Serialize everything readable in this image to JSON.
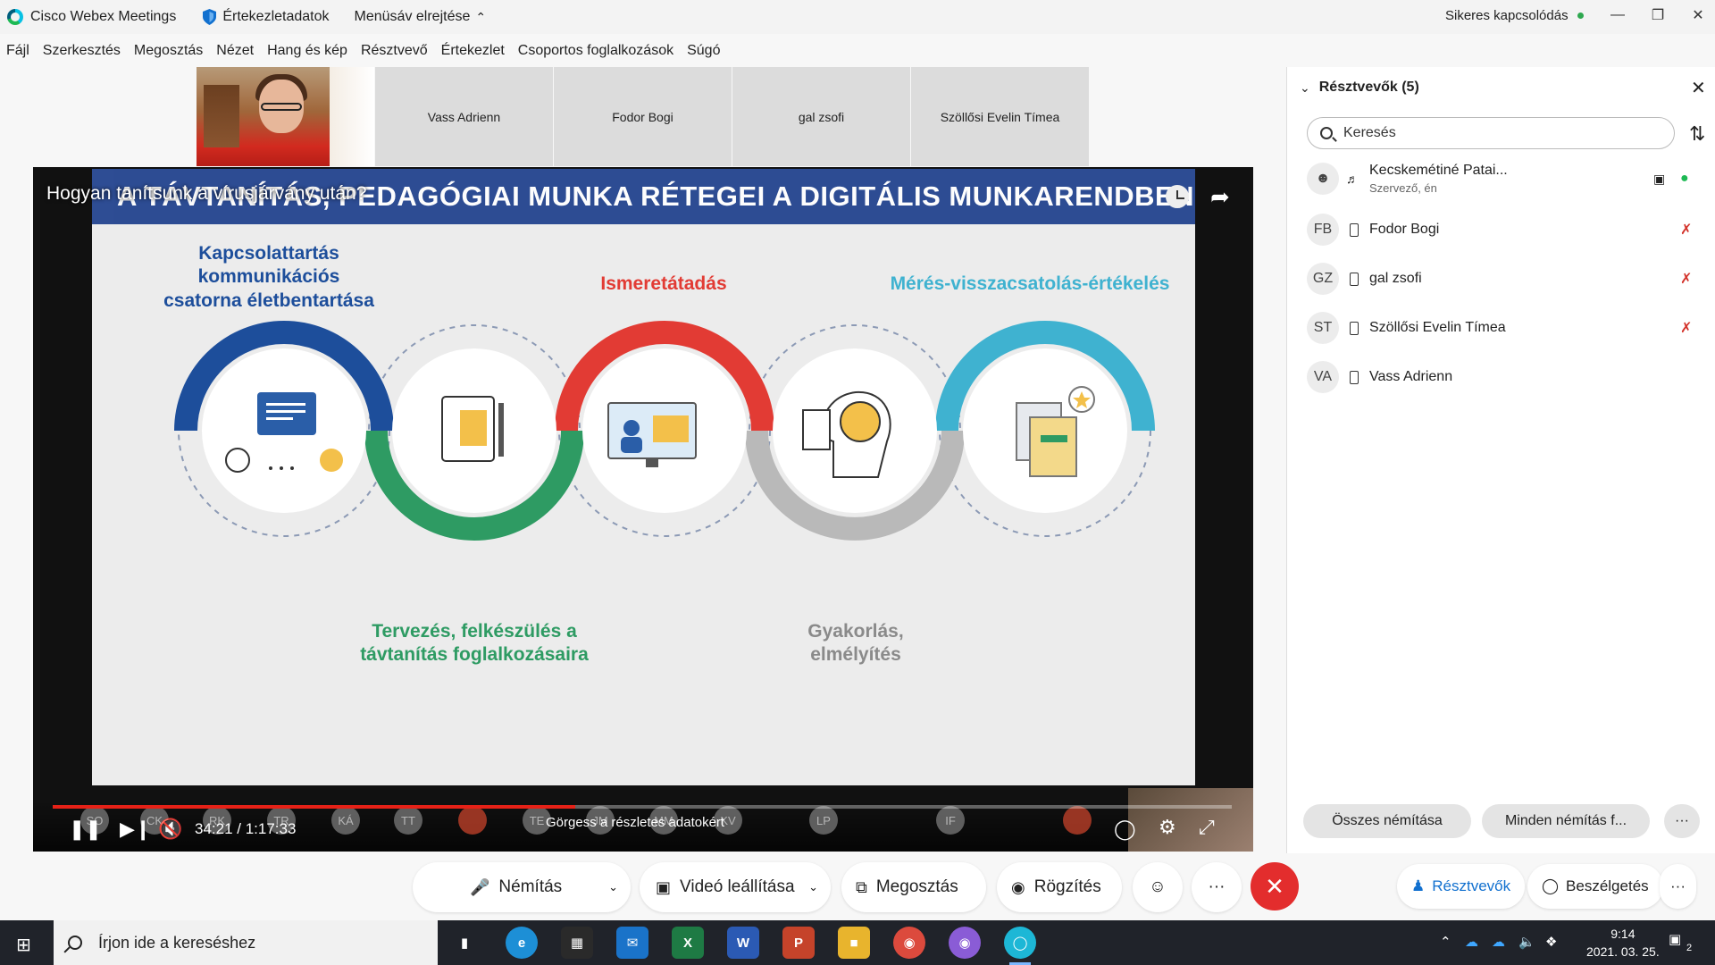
{
  "titlebar": {
    "app_name": "Cisco Webex Meetings",
    "meeting_info": "Értekezletadatok",
    "hide_menu": "Menüsáv elrejtése",
    "status": "Sikeres kapcsolódás"
  },
  "menu": [
    "Fájl",
    "Szerkesztés",
    "Megosztás",
    "Nézet",
    "Hang és kép",
    "Résztvevő",
    "Értekezlet",
    "Csoportos foglalkozások",
    "Súgó"
  ],
  "thumbnails": [
    "Vass Adrienn",
    "Fodor Bogi",
    "gal zsofi",
    "Szöllősi Evelin Tímea"
  ],
  "video": {
    "title": "Hogyan tanítsunk a vírusjárvány után?",
    "slide_header": "A TÁVTANÍTÁS, PEDAGÓGIAI MUNKA RÉTEGEI A DIGITÁLIS MUNKARENDBEN",
    "labels": {
      "kapcsolat": "Kapcsolattartás kommunikációs csatorna életbentartása",
      "ismeret": "Ismeretátadás",
      "meres": "Mérés-visszacsatolás-értékelés",
      "tervezes": "Tervezés, felkészülés a távtanítás foglalkozásaira",
      "gyakorlas": "Gyakorlás, elmélyítés"
    },
    "time": "34:21 / 1:17:33",
    "progress": 0.443,
    "scroll_hint": "Görgess a részletes adatokért",
    "strip_avatars": [
      "SO",
      "CK",
      "RK",
      "TR",
      "KÁ",
      "TT",
      "",
      "TE",
      "JM",
      "MM",
      "KV",
      "LP",
      "IF",
      ""
    ]
  },
  "panel": {
    "title": "Résztvevők (5)",
    "search_placeholder": "Keresés",
    "participants": [
      {
        "initials": "",
        "name": "Kecskemétiné Patai...",
        "role": "Szervező, én"
      },
      {
        "initials": "FB",
        "name": "Fodor Bogi"
      },
      {
        "initials": "GZ",
        "name": "gal zsofi"
      },
      {
        "initials": "ST",
        "name": "Szöllősi Evelin Tímea"
      },
      {
        "initials": "VA",
        "name": "Vass Adrienn"
      }
    ],
    "mute_all": "Összes némítása",
    "unmute_all": "Minden némítás f...",
    "more": "···"
  },
  "controls": {
    "mute": "Némítás",
    "video": "Videó leállítása",
    "share": "Megosztás",
    "record": "Rögzítés",
    "more": "···",
    "participants": "Résztvevők",
    "chat": "Beszélgetés"
  },
  "taskbar": {
    "search_placeholder": "Írjon ide a kereséshez",
    "time": "9:14",
    "date": "2021. 03. 25.",
    "notifications": "2"
  },
  "colors": {
    "accent": "#1170cf",
    "leave": "#e32d2d",
    "blue_ring": "#1d4e9b",
    "green_ring": "#2e9b63",
    "red_ring": "#e23b34",
    "gray_ring": "#b9b9b9",
    "cyan_ring": "#3fb2d0"
  }
}
